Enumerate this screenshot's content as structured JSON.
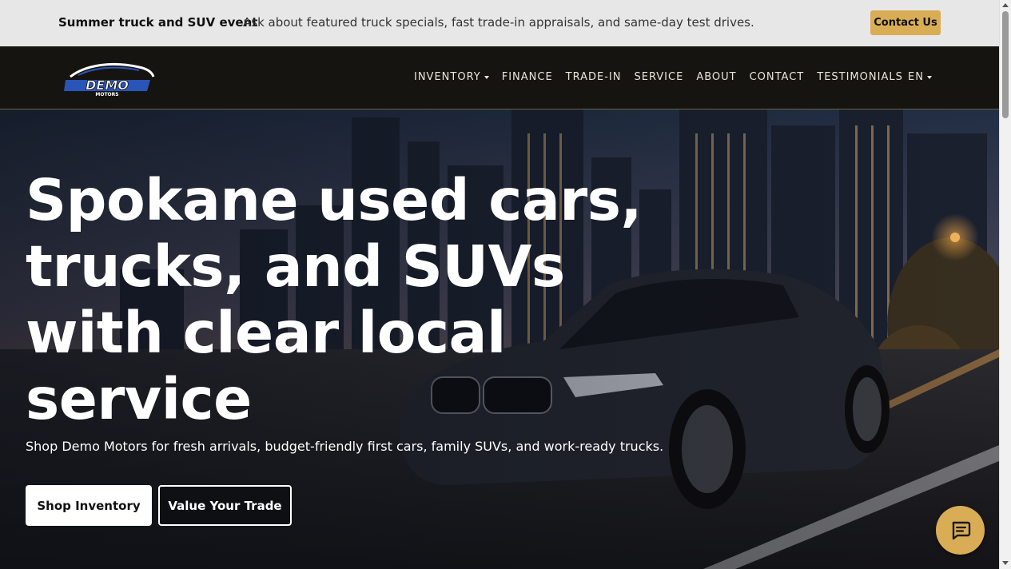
{
  "promo": {
    "title": "Summer truck and SUV event",
    "text": "Ask about featured truck specials, fast trade-in appraisals, and same-day test drives.",
    "contact_label": "Contact Us"
  },
  "header": {
    "logo_text": "DEMO",
    "logo_subtext": "MOTORS",
    "nav": [
      {
        "label": "INVENTORY",
        "has_dropdown": true
      },
      {
        "label": "FINANCE"
      },
      {
        "label": "TRADE-IN"
      },
      {
        "label": "SERVICE"
      },
      {
        "label": "ABOUT"
      },
      {
        "label": "CONTACT"
      },
      {
        "label": "TESTIMONIALS"
      }
    ],
    "language": "EN"
  },
  "hero": {
    "headline": "Spokane used cars, trucks, and SUVs with clear local service",
    "subtext": "Shop Demo Motors for fresh arrivals, budget-friendly first cars, family SUVs, and work-ready trucks.",
    "primary_cta": "Shop Inventory",
    "secondary_cta": "Value Your Trade"
  },
  "colors": {
    "accent": "#d9ad55",
    "header_bg": "#161410",
    "promo_bg": "#e7e7e7"
  },
  "icons": {
    "chat": "chat-bubble-icon",
    "dropdown": "chevron-down-icon"
  }
}
